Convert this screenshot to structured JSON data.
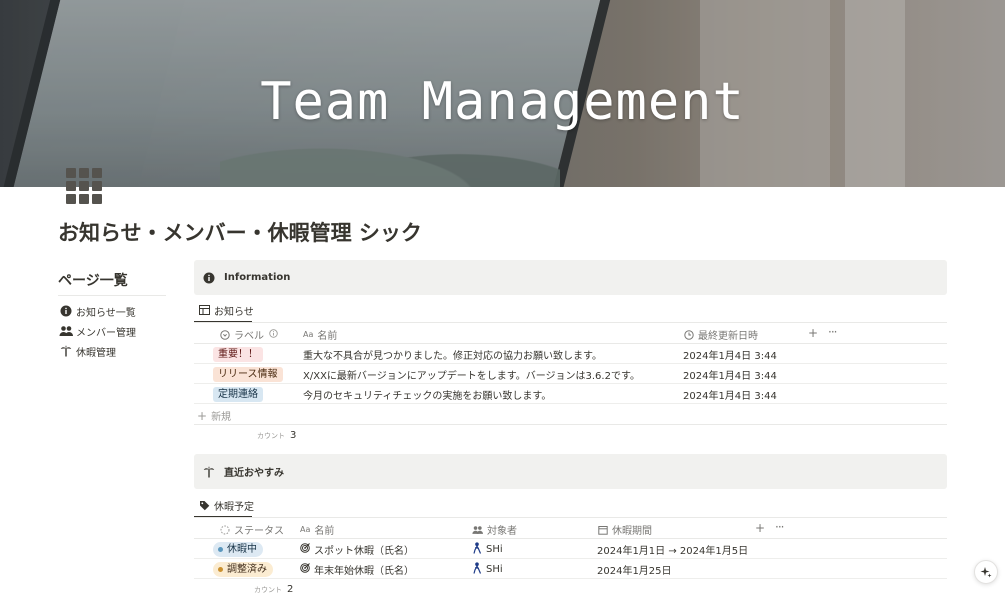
{
  "cover": {
    "title": "Team Management"
  },
  "page": {
    "title": "お知らせ・メンバー・休暇管理 シック"
  },
  "sidebar": {
    "heading": "ページ一覧",
    "items": [
      {
        "label": "お知らせ一覧",
        "icon": "info-icon"
      },
      {
        "label": "メンバー管理",
        "icon": "people-icon"
      },
      {
        "label": "休暇管理",
        "icon": "palm-tree-icon"
      }
    ]
  },
  "info_callout": {
    "title": "Information",
    "icon": "info-icon"
  },
  "notices": {
    "view_tab": "お知らせ",
    "columns": {
      "label": "ラベル",
      "name": "名前",
      "updated": "最終更新日時"
    },
    "rows": [
      {
        "label": "重要！！",
        "label_color": "#fbe4e4",
        "label_text": "#5d1715",
        "name": "重大な不具合が見つかりました。修正対応の協力お願い致します。",
        "updated": "2024年1月4日 3:44"
      },
      {
        "label": "リリース情報",
        "label_color": "#fae3d6",
        "label_text": "#49290e",
        "name": "X/XXに最新バージョンにアップデートをします。バージョンは3.6.2です。",
        "updated": "2024年1月4日 3:44"
      },
      {
        "label": "定期連絡",
        "label_color": "#d8e7f2",
        "label_text": "#183347",
        "name": "今月のセキュリティチェックの実施をお願い致します。",
        "updated": "2024年1月4日 3:44"
      }
    ],
    "new_label": "新規",
    "count_label": "カウント",
    "count": "3"
  },
  "vacation_callout": {
    "title": "直近おやすみ",
    "icon": "palm-tree-icon"
  },
  "vacations": {
    "view_tab": "休暇予定",
    "columns": {
      "status": "ステータス",
      "name": "名前",
      "target": "対象者",
      "period": "休暇期間"
    },
    "rows": [
      {
        "status": "休暇中",
        "status_bg": "#dde9f3",
        "status_dot": "#5b97bd",
        "name": "スポット休暇（氏名）",
        "target": "SHi",
        "period": "2024年1月1日 → 2024年1月5日"
      },
      {
        "status": "調整済み",
        "status_bg": "#fbecd2",
        "status_dot": "#cb912f",
        "name": "年末年始休暇（氏名）",
        "target": "SHi",
        "period": "2024年1月25日"
      }
    ],
    "count_label": "カウント",
    "count": "2"
  }
}
